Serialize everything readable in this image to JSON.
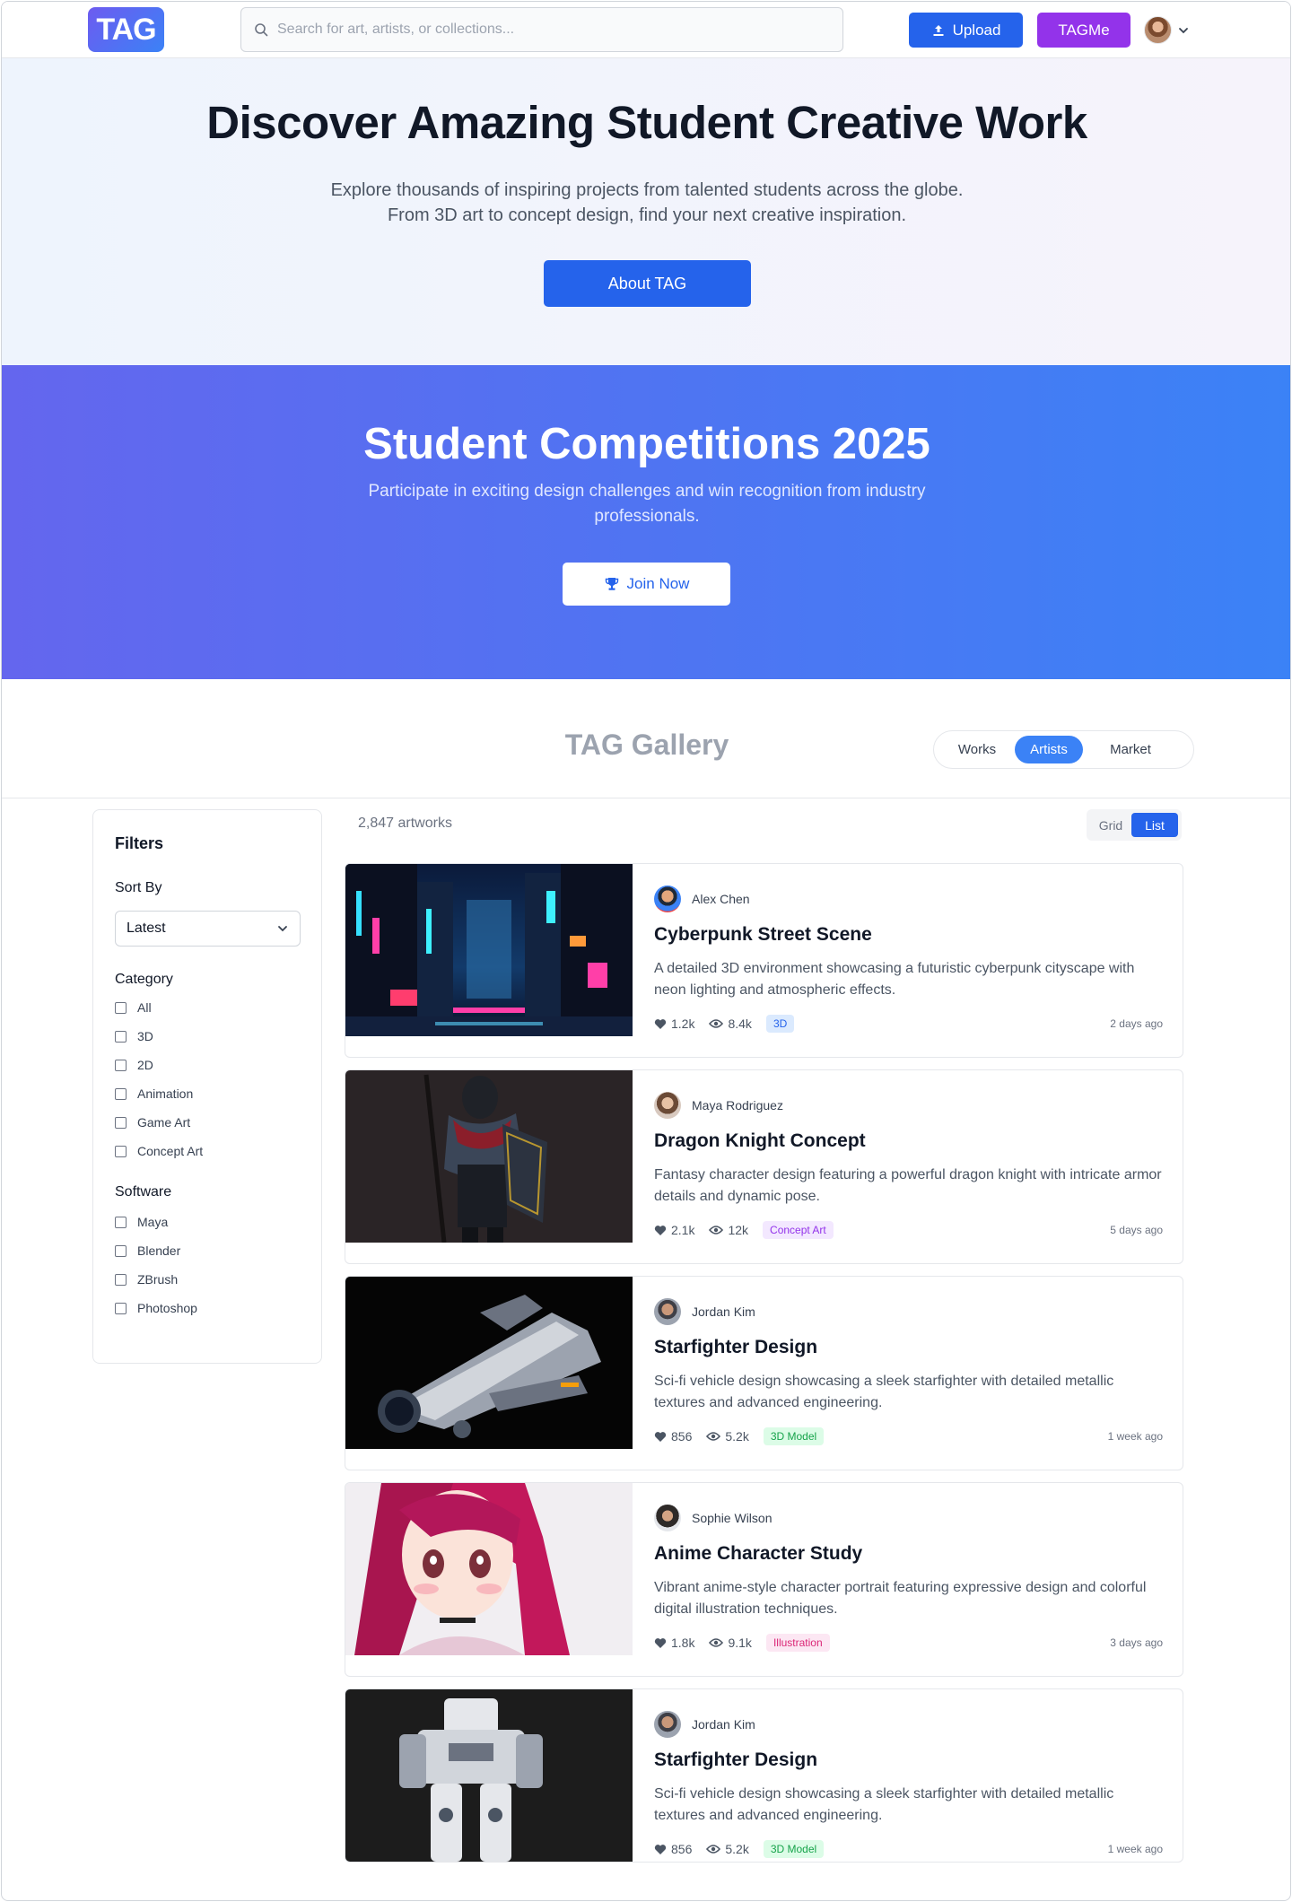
{
  "header": {
    "logo": "TAG",
    "search_placeholder": "Search for art, artists, or collections...",
    "upload_label": "Upload",
    "tagme_label": "TAGMe"
  },
  "hero": {
    "title": "Discover Amazing Student Creative Work",
    "line1": "Explore thousands of inspiring projects from talented students across the globe.",
    "line2": "From 3D art to concept design, find your next creative inspiration.",
    "button": "About TAG"
  },
  "competitions": {
    "title": "Student Competitions 2025",
    "line1": "Participate in exciting design challenges and win recognition from industry",
    "line2": "professionals.",
    "button": "Join Now"
  },
  "gallery": {
    "title": "TAG Gallery",
    "tabs": [
      "Works",
      "Artists",
      "Market"
    ],
    "active_tab": "Artists"
  },
  "filters": {
    "title": "Filters",
    "sort_label": "Sort By",
    "sort_value": "Latest",
    "category_label": "Category",
    "categories": [
      "All",
      "3D",
      "2D",
      "Animation",
      "Game Art",
      "Concept Art"
    ],
    "software_label": "Software",
    "software": [
      "Maya",
      "Blender",
      "ZBrush",
      "Photoshop"
    ]
  },
  "results": {
    "count": "2,847 artworks",
    "view_grid": "Grid",
    "view_list": "List",
    "active_view": "List"
  },
  "artworks": [
    {
      "author": "Alex Chen",
      "title": "Cyberpunk Street Scene",
      "desc": "A detailed 3D environment showcasing a futuristic cyberpunk cityscape with neon lighting and atmospheric effects.",
      "likes": "1.2k",
      "views": "8.4k",
      "tag": "3D",
      "tag_color": "#2563eb",
      "time": "2 days ago"
    },
    {
      "author": "Maya Rodriguez",
      "title": "Dragon Knight Concept",
      "desc": "Fantasy character design featuring a powerful dragon knight with intricate armor details and dynamic pose.",
      "likes": "2.1k",
      "views": "12k",
      "tag": "Concept Art",
      "tag_color": "#9333ea",
      "time": "5 days ago"
    },
    {
      "author": "Jordan Kim",
      "title": "Starfighter Design",
      "desc": "Sci-fi vehicle design showcasing a sleek starfighter with detailed metallic textures and advanced engineering.",
      "likes": "856",
      "views": "5.2k",
      "tag": "3D Model",
      "tag_color": "#16a34a",
      "time": "1 week ago"
    },
    {
      "author": "Sophie Wilson",
      "title": "Anime Character Study",
      "desc": "Vibrant anime-style character portrait featuring expressive design and colorful digital illustration techniques.",
      "likes": "1.8k",
      "views": "9.1k",
      "tag": "Illustration",
      "tag_color": "#db2777",
      "time": "3 days ago"
    },
    {
      "author": "Jordan Kim",
      "title": "Starfighter Design",
      "desc": "Sci-fi vehicle design showcasing a sleek starfighter with detailed metallic textures and advanced engineering.",
      "likes": "856",
      "views": "5.2k",
      "tag": "3D Model",
      "tag_color": "#16a34a",
      "time": "1 week ago"
    }
  ],
  "colors": {
    "primary": "#2563eb",
    "tagme": "#9333ea",
    "banner_start": "#6466ee",
    "banner_end": "#3b82f6"
  }
}
